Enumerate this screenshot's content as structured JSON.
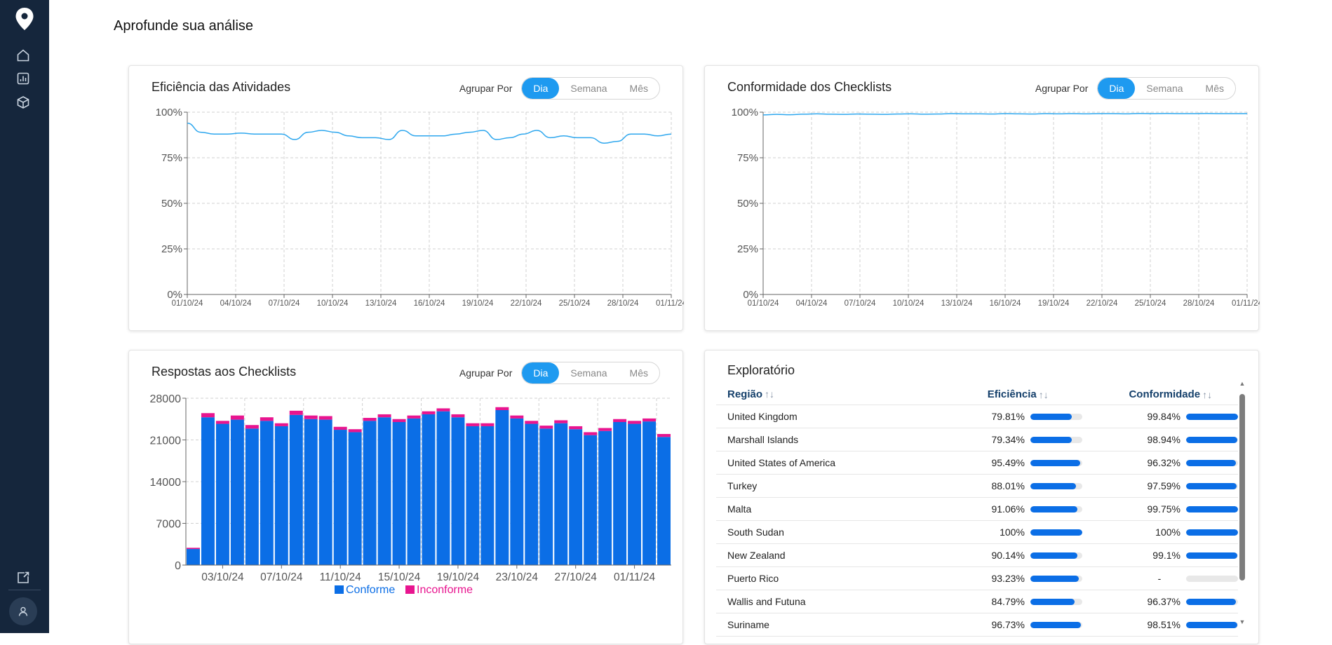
{
  "page": {
    "title": "Aprofunde sua análise"
  },
  "sidebar": {
    "items": [
      {
        "name": "home-icon"
      },
      {
        "name": "bar-chart-icon"
      },
      {
        "name": "cube-icon"
      }
    ],
    "bottom": [
      {
        "name": "exit-app-icon"
      },
      {
        "name": "user-icon"
      }
    ]
  },
  "group_label": "Agrupar Por",
  "group_options": [
    "Dia",
    "Semana",
    "Mês"
  ],
  "cards": {
    "eficiencia": {
      "title": "Eficiência das Atividades"
    },
    "conformidade": {
      "title": "Conformidade dos Checklists"
    },
    "respostas": {
      "title": "Respostas aos Checklists"
    }
  },
  "chart_data": [
    {
      "type": "line",
      "title": "Eficiência das Atividades",
      "x_ticks": [
        "01/10/24",
        "04/10/24",
        "07/10/24",
        "10/10/24",
        "13/10/24",
        "16/10/24",
        "19/10/24",
        "22/10/24",
        "25/10/24",
        "28/10/24",
        "01/11/24"
      ],
      "y_ticks": [
        "0%",
        "25%",
        "50%",
        "75%",
        "100%"
      ],
      "ylim": [
        0,
        100
      ],
      "color": "#2ea7ee",
      "values": [
        94,
        89,
        88,
        88,
        88.5,
        88,
        88,
        88,
        85,
        89,
        90,
        89,
        87,
        86,
        86,
        85,
        90,
        87,
        87,
        87,
        88,
        89,
        90,
        85,
        86,
        88,
        90,
        86,
        87,
        86,
        86,
        83,
        84,
        88,
        88,
        87,
        88
      ]
    },
    {
      "type": "line",
      "title": "Conformidade dos Checklists",
      "x_ticks": [
        "01/10/24",
        "04/10/24",
        "07/10/24",
        "10/10/24",
        "13/10/24",
        "16/10/24",
        "19/10/24",
        "22/10/24",
        "25/10/24",
        "28/10/24",
        "01/11/24"
      ],
      "y_ticks": [
        "0%",
        "25%",
        "50%",
        "75%",
        "100%"
      ],
      "ylim": [
        0,
        100
      ],
      "color": "#2ea7ee",
      "values": [
        98.5,
        98.8,
        98.6,
        98.9,
        99.1,
        98.9,
        98.8,
        99,
        98.9,
        98.8,
        99,
        99.1,
        98.9,
        99,
        99.2,
        99.1,
        99.1,
        99,
        99.2,
        99.1,
        99,
        99.2,
        99.1,
        99.2,
        99.1,
        99.2,
        99.2,
        99.1,
        99.3,
        99.2,
        99.3,
        99.2,
        99.2,
        99.3,
        99.2,
        99.2,
        99.2
      ]
    },
    {
      "type": "bar",
      "stacked": true,
      "title": "Respostas aos Checklists",
      "x_ticks": [
        "03/10/24",
        "07/10/24",
        "11/10/24",
        "15/10/24",
        "19/10/24",
        "23/10/24",
        "27/10/24",
        "01/11/24"
      ],
      "y_ticks": [
        "0",
        "7000",
        "14000",
        "21000",
        "28000"
      ],
      "ylim": [
        0,
        28000
      ],
      "series": [
        {
          "name": "Conforme",
          "color": "#0b6ee6",
          "values": [
            2700,
            24800,
            23700,
            24400,
            22900,
            24200,
            23300,
            25200,
            24500,
            24400,
            22700,
            22300,
            24200,
            24800,
            24000,
            24600,
            25300,
            25800,
            24800,
            23300,
            23300,
            26000,
            24600,
            23700,
            22900,
            23800,
            22800,
            21800,
            22500,
            24000,
            23700,
            24100,
            21500
          ]
        },
        {
          "name": "Inconforme",
          "color": "#e8158f",
          "values": [
            200,
            700,
            500,
            700,
            600,
            600,
            500,
            700,
            600,
            600,
            500,
            500,
            500,
            500,
            500,
            500,
            500,
            500,
            500,
            500,
            500,
            500,
            500,
            500,
            500,
            500,
            500,
            500,
            500,
            500,
            500,
            500,
            500
          ]
        }
      ]
    }
  ],
  "exploratorio": {
    "title": "Exploratório",
    "headers": {
      "regiao": "Região",
      "eficiencia": "Eficiência",
      "conformidade": "Conformidade",
      "sort_glyph": "↑↓"
    },
    "rows": [
      {
        "region": "United Kingdom",
        "eff": "79.81%",
        "eff_v": 0.7981,
        "conf": "99.84%",
        "conf_v": 0.9984
      },
      {
        "region": "Marshall Islands",
        "eff": "79.34%",
        "eff_v": 0.7934,
        "conf": "98.94%",
        "conf_v": 0.9894
      },
      {
        "region": "United States of America",
        "eff": "95.49%",
        "eff_v": 0.9549,
        "conf": "96.32%",
        "conf_v": 0.9632
      },
      {
        "region": "Turkey",
        "eff": "88.01%",
        "eff_v": 0.8801,
        "conf": "97.59%",
        "conf_v": 0.9759
      },
      {
        "region": "Malta",
        "eff": "91.06%",
        "eff_v": 0.9106,
        "conf": "99.75%",
        "conf_v": 0.9975
      },
      {
        "region": "South Sudan",
        "eff": "100%",
        "eff_v": 1.0,
        "conf": "100%",
        "conf_v": 1.0
      },
      {
        "region": "New Zealand",
        "eff": "90.14%",
        "eff_v": 0.9014,
        "conf": "99.1%",
        "conf_v": 0.991
      },
      {
        "region": "Puerto Rico",
        "eff": "93.23%",
        "eff_v": 0.9323,
        "conf": "-",
        "conf_v": 0
      },
      {
        "region": "Wallis and Futuna",
        "eff": "84.79%",
        "eff_v": 0.8479,
        "conf": "96.37%",
        "conf_v": 0.9637
      },
      {
        "region": "Suriname",
        "eff": "96.73%",
        "eff_v": 0.9673,
        "conf": "98.51%",
        "conf_v": 0.9851
      }
    ]
  }
}
